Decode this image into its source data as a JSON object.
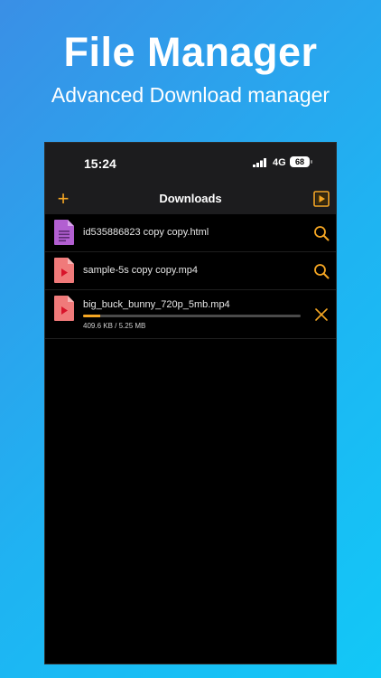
{
  "banner": {
    "title": "File Manager",
    "subtitle": "Advanced Download manager"
  },
  "status_bar": {
    "time": "15:24",
    "network": "4G",
    "battery": "68"
  },
  "nav": {
    "title": "Downloads",
    "add_icon": "plus-icon",
    "player_icon": "play-square-icon",
    "accent_color": "#f5a623"
  },
  "downloads": [
    {
      "name": "id535886823 copy copy.html",
      "file_type": "html",
      "action_icon": "search-icon"
    },
    {
      "name": "sample-5s copy copy.mp4",
      "file_type": "video",
      "action_icon": "search-icon"
    },
    {
      "name": "big_buck_bunny_720p_5mb.mp4",
      "file_type": "video",
      "action_icon": "close-icon",
      "progress_text": "409.6 KB / 5.25 MB",
      "progress_fraction": 0.078
    }
  ]
}
